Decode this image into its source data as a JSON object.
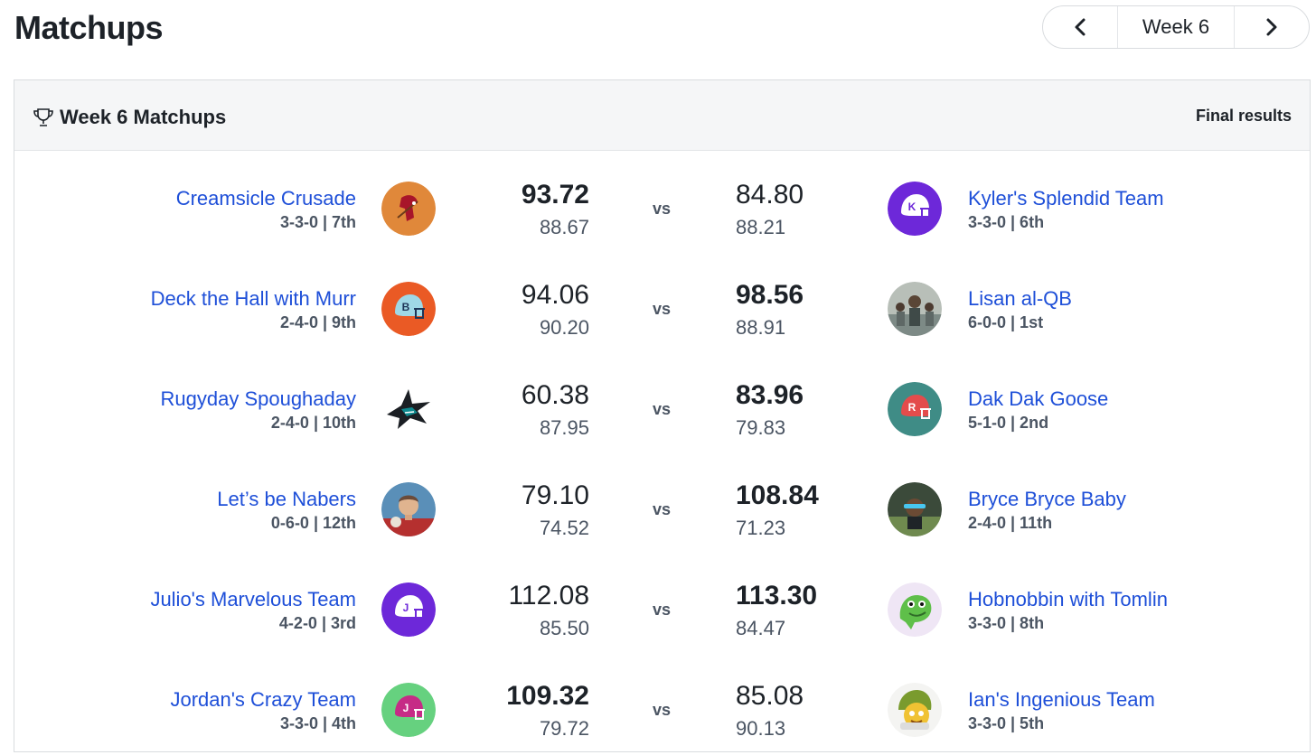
{
  "page": {
    "title": "Matchups"
  },
  "week_nav": {
    "prev_icon": "chevron-left-icon",
    "label": "Week 6",
    "next_icon": "chevron-right-icon"
  },
  "card": {
    "title": "Week 6 Matchups",
    "title_icon": "trophy-icon",
    "status": "Final results"
  },
  "vs_label": "vs",
  "matchups": [
    {
      "left": {
        "name": "Creamsicle Crusade",
        "record": "3-3-0 | 7th",
        "score": "93.72",
        "projected": "88.67",
        "winner": true,
        "avatar": "buccaneer-logo"
      },
      "right": {
        "name": "Kyler's Splendid Team",
        "record": "3-3-0 | 6th",
        "score": "84.80",
        "projected": "88.21",
        "winner": false,
        "avatar": "helmet-K-purple"
      }
    },
    {
      "left": {
        "name": "Deck the Hall with Murr",
        "record": "2-4-0 | 9th",
        "score": "94.06",
        "projected": "90.20",
        "winner": false,
        "avatar": "helmet-B-orange"
      },
      "right": {
        "name": "Lisan al-QB",
        "record": "6-0-0 | 1st",
        "score": "98.56",
        "projected": "88.91",
        "winner": true,
        "avatar": "photo-group"
      }
    },
    {
      "left": {
        "name": "Rugyday Spoughaday",
        "record": "2-4-0 | 10th",
        "score": "60.38",
        "projected": "87.95",
        "winner": false,
        "avatar": "shark-logo"
      },
      "right": {
        "name": "Dak Dak Goose",
        "record": "5-1-0 | 2nd",
        "score": "83.96",
        "projected": "79.83",
        "winner": true,
        "avatar": "helmet-R-teal"
      }
    },
    {
      "left": {
        "name": "Let’s be Nabers",
        "record": "0-6-0 | 12th",
        "score": "79.10",
        "projected": "74.52",
        "winner": false,
        "avatar": "photo-man"
      },
      "right": {
        "name": "Bryce Bryce Baby",
        "record": "2-4-0 | 11th",
        "score": "108.84",
        "projected": "71.23",
        "winner": true,
        "avatar": "photo-player"
      }
    },
    {
      "left": {
        "name": "Julio's Marvelous Team",
        "record": "4-2-0 | 3rd",
        "score": "112.08",
        "projected": "85.50",
        "winner": false,
        "avatar": "helmet-J-purple"
      },
      "right": {
        "name": "Hobnobbin with Tomlin",
        "record": "3-3-0 | 8th",
        "score": "113.30",
        "projected": "84.47",
        "winner": true,
        "avatar": "dinosaur-cartoon"
      }
    },
    {
      "left": {
        "name": "Jordan's Crazy Team",
        "record": "3-3-0 | 4th",
        "score": "109.32",
        "projected": "79.72",
        "winner": true,
        "avatar": "helmet-J-green"
      },
      "right": {
        "name": "Ian's Ingenious Team",
        "record": "3-3-0 | 5th",
        "score": "85.08",
        "projected": "90.13",
        "winner": false,
        "avatar": "cartoon-helmet-face"
      }
    }
  ]
}
